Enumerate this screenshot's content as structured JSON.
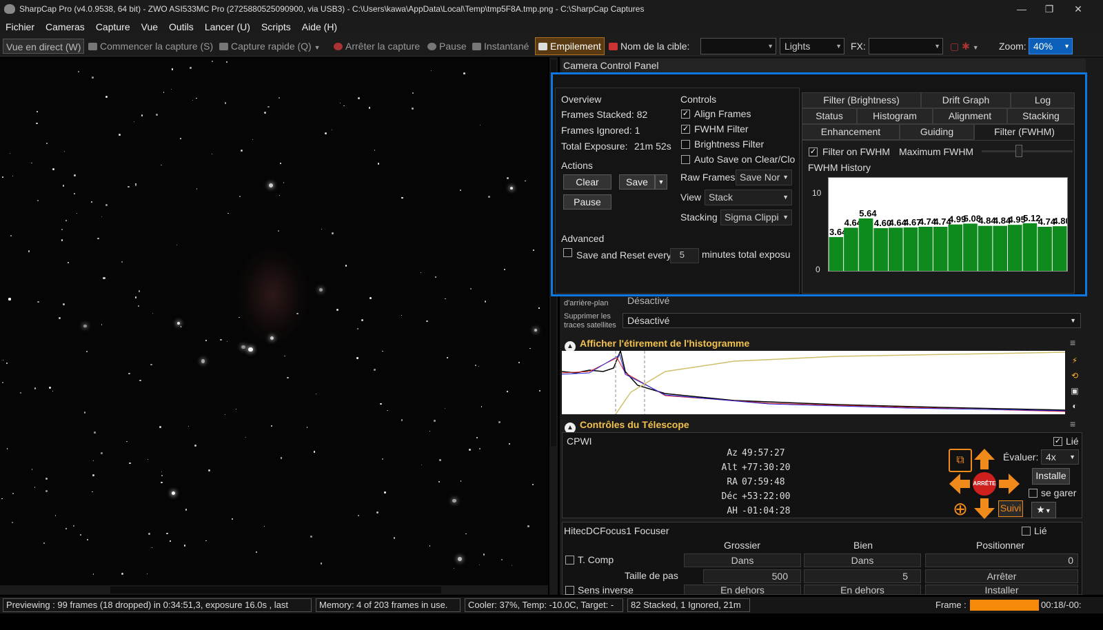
{
  "window": {
    "title": "SharpCap Pro (v4.0.9538, 64 bit) - ZWO ASI533MC Pro (2725880525090900, via USB3) - C:\\Users\\kawa\\AppData\\Local\\Temp\\tmp5F8A.tmp.png - C:\\SharpCap Captures"
  },
  "menu": [
    "Fichier",
    "Cameras",
    "Capture",
    "Vue",
    "Outils",
    "Lancer (U)",
    "Scripts",
    "Aide (H)"
  ],
  "toolbar": {
    "live_view": "Vue en direct (W)",
    "start_capture": "Commencer la capture (S)",
    "quick_capture": "Capture rapide (Q)",
    "stop_capture": "Arrêter la capture",
    "pause": "Pause",
    "snapshot": "Instantané",
    "stacking": "Empilement",
    "target_label": "Nom de la cible:",
    "target_value": "",
    "frame_type": "Lights",
    "fx_label": "FX:",
    "fx_value": "",
    "zoom_label": "Zoom:",
    "zoom_value": "40%"
  },
  "ccp": {
    "title": "Camera Control Panel",
    "overview": {
      "header": "Overview",
      "frames_stacked": "Frames Stacked: 82",
      "frames_ignored": "Frames Ignored: 1",
      "total_exposure_label": "Total Exposure:",
      "total_exposure_value": "21m 52s"
    },
    "actions": {
      "header": "Actions",
      "clear": "Clear",
      "save": "Save",
      "pause": "Pause"
    },
    "advanced": {
      "header": "Advanced",
      "save_reset_label": "Save and Reset every",
      "minutes_value": "5",
      "minutes_suffix": "minutes total exposu"
    },
    "controls": {
      "header": "Controls",
      "align_frames": "Align Frames",
      "fwhm_filter": "FWHM Filter",
      "brightness_filter": "Brightness Filter",
      "auto_save": "Auto Save on Clear/Clo",
      "raw_frames_label": "Raw Frames",
      "raw_frames_value": "Save Nor",
      "view_label": "View",
      "view_value": "Stack",
      "stacking_label": "Stacking",
      "stacking_value": "Sigma Clippi"
    },
    "tabs_row1": [
      "Filter (Brightness)",
      "Drift Graph",
      "Log"
    ],
    "tabs_row2": [
      "Status",
      "Histogram",
      "Alignment",
      "Stacking"
    ],
    "tabs_row3": [
      "Enhancement",
      "Guiding",
      "Filter (FWHM)"
    ],
    "filter_on_fwhm": "Filter on FWHM",
    "max_fwhm": "Maximum FWHM",
    "fwhm_history": "FWHM History",
    "fwhm_y_max": "10",
    "fwhm_y_min": "0",
    "fwhm_labels": [
      "3.64",
      "4.64",
      "5.64",
      "4.60",
      "4.64",
      "4.67",
      "4.74",
      "4.74",
      "4.99",
      "5.08",
      "4.84",
      "4.84",
      "4.95",
      "5.12",
      "4.74",
      "4.80"
    ]
  },
  "chart_data": {
    "type": "bar",
    "title": "FWHM History",
    "ylim": [
      0,
      10
    ],
    "values": [
      3.64,
      4.64,
      5.64,
      4.6,
      4.64,
      4.67,
      4.74,
      4.74,
      4.99,
      5.08,
      4.84,
      4.84,
      4.95,
      5.12,
      4.74,
      4.8
    ],
    "color": "#0f8a1c"
  },
  "background": {
    "label1": "d'arrière-plan",
    "value1": "Désactivé",
    "label2a": "Supprimer les",
    "label2b": "traces satellites",
    "value2": "Désactivé"
  },
  "histogram": {
    "header": "Afficher l'étirement de l'histogramme"
  },
  "telescope": {
    "header": "Contrôles du Télescope",
    "device": "CPWI",
    "linked": "Lié",
    "rate_label": "Évaluer:",
    "rate_value": "4x",
    "install": "Installe",
    "park": "se garer",
    "stop": "ARRÊTE",
    "track": "Suivi",
    "coords": [
      {
        "label": "Az",
        "value": "49:57:27"
      },
      {
        "label": "Alt",
        "value": "+77:30:20"
      },
      {
        "label": "RA",
        "value": "07:59:48"
      },
      {
        "label": "Déc",
        "value": "+53:22:00"
      },
      {
        "label": "AH",
        "value": "-01:04:28"
      }
    ]
  },
  "focuser": {
    "name": "HitecDCFocus1 Focuser",
    "linked": "Lié",
    "col_coarse": "Grossier",
    "col_fine": "Bien",
    "col_position": "Positionner",
    "tcomp": "T. Comp",
    "in1": "Dans",
    "in2": "Dans",
    "position": "0",
    "step_label": "Taille de pas",
    "step_coarse": "500",
    "step_fine": "5",
    "stop": "Arrêter",
    "reverse": "Sens inverse",
    "out1": "En dehors",
    "out2": "En dehors",
    "install": "Installer"
  },
  "status": {
    "preview": "Previewing : 99 frames (18 dropped) in 0:34:51,3, exposure 16.0s , last",
    "memory": "Memory: 4 of 203 frames in use.",
    "cooler": "Cooler: 37%, Temp: -10.0C, Target: -",
    "stacked": "82 Stacked, 1 Ignored, 21m",
    "frame_label": "Frame :",
    "frame_time": "00:18/-00:"
  },
  "colors": {
    "accent": "#0b78e3",
    "bar": "#0f8a1c",
    "header": "#f2c14e",
    "arrow": "#f08a1a"
  }
}
